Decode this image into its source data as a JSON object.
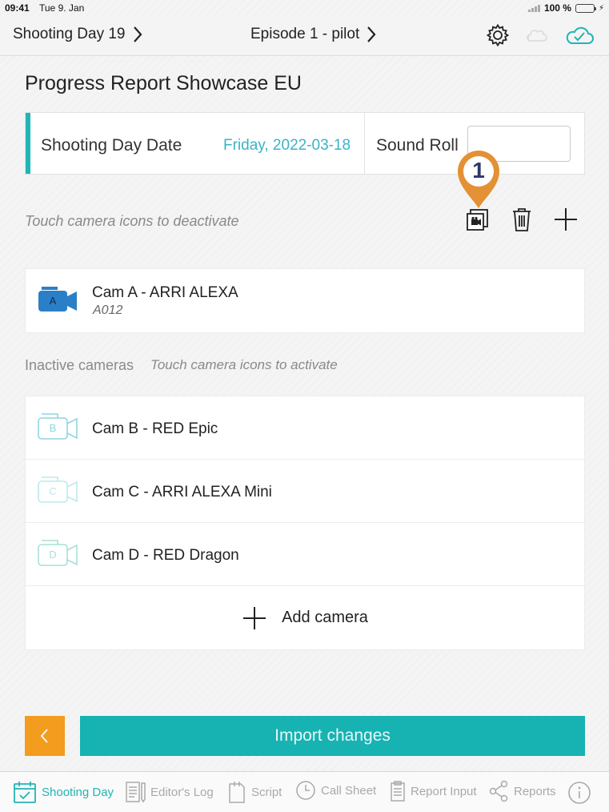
{
  "status_bar": {
    "time": "09:41",
    "date": "Tue 9. Jan",
    "battery": "100 %"
  },
  "nav": {
    "left_label": "Shooting Day 19",
    "center_label": "Episode 1 - pilot"
  },
  "page_title": "Progress Report Showcase EU",
  "date_card": {
    "date_label": "Shooting Day Date",
    "date_value": "Friday, 2022-03-18",
    "sound_roll_label": "Sound Roll",
    "sound_roll_value": ""
  },
  "marker": {
    "number": "1"
  },
  "hints": {
    "deactivate": "Touch camera icons to deactivate",
    "inactive_title": "Inactive cameras",
    "activate": "Touch camera icons to activate"
  },
  "active_cameras": [
    {
      "letter": "A",
      "name": "Cam A - ARRI ALEXA",
      "roll": "A012"
    }
  ],
  "inactive_cameras": [
    {
      "letter": "B",
      "name": "Cam B - RED Epic"
    },
    {
      "letter": "C",
      "name": "Cam C - ARRI ALEXA Mini"
    },
    {
      "letter": "D",
      "name": "Cam D - RED Dragon"
    }
  ],
  "add_camera_label": "Add camera",
  "import_label": "Import changes",
  "tabs": [
    {
      "label": "Shooting Day"
    },
    {
      "label": "Editor's Log"
    },
    {
      "label": "Script"
    },
    {
      "label": "Call Sheet"
    },
    {
      "label": "Report Input"
    },
    {
      "label": "Reports"
    }
  ],
  "colors": {
    "accent_teal": "#17b2b2",
    "active_camera_blue": "#2b7fc6",
    "inactive_camera_cyan": "#8fd6e2",
    "back_orange": "#f39c1e",
    "marker_orange": "#e39134"
  }
}
